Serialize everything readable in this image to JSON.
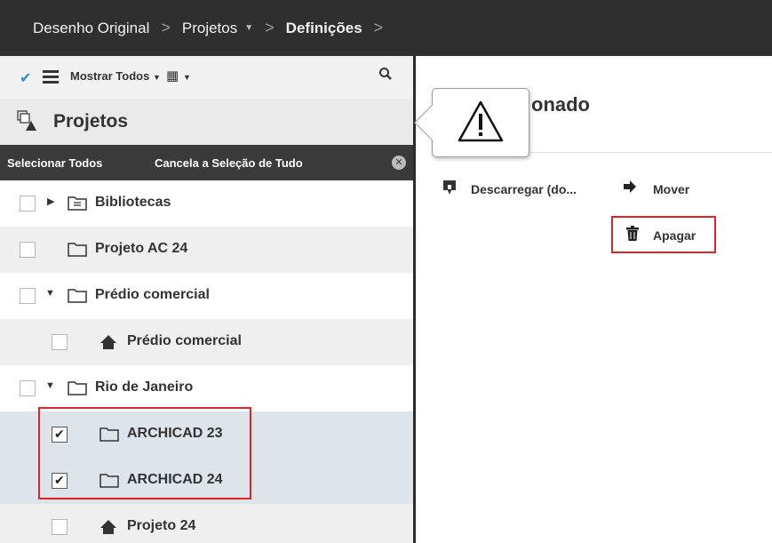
{
  "breadcrumb": {
    "items": [
      "Desenho Original",
      "Projetos",
      "Definições"
    ]
  },
  "toolbar": {
    "show_label": "Mostrar Todos"
  },
  "panel": {
    "title": "Projetos"
  },
  "selection": {
    "select_all": "Selecionar Todos",
    "deselect_all": "Cancela a Seleção de Tudo"
  },
  "tree": {
    "items": [
      {
        "label": "Bibliotecas",
        "checked": false,
        "icon": "library-folder-icon"
      },
      {
        "label": "Projeto AC 24",
        "checked": false,
        "icon": "folder-icon"
      },
      {
        "label": "Prédio comercial",
        "checked": false,
        "icon": "folder-icon",
        "expanded": true
      },
      {
        "label": "Prédio comercial",
        "checked": false,
        "icon": "project-icon"
      },
      {
        "label": "Rio de Janeiro",
        "checked": false,
        "icon": "folder-icon",
        "expanded": true
      },
      {
        "label": "ARCHICAD 23",
        "checked": true,
        "icon": "folder-icon"
      },
      {
        "label": "ARCHICAD 24",
        "checked": true,
        "icon": "folder-icon"
      },
      {
        "label": "Projeto 24",
        "checked": false,
        "icon": "project-icon"
      }
    ]
  },
  "details": {
    "title_partial": "onado"
  },
  "actions": {
    "download": "Descarregar (do...",
    "move": "Mover",
    "delete": "Apagar"
  },
  "colors": {
    "highlight": "#e2232a",
    "topbar": "#2f2f2f",
    "accent": "#2e8fd6"
  }
}
